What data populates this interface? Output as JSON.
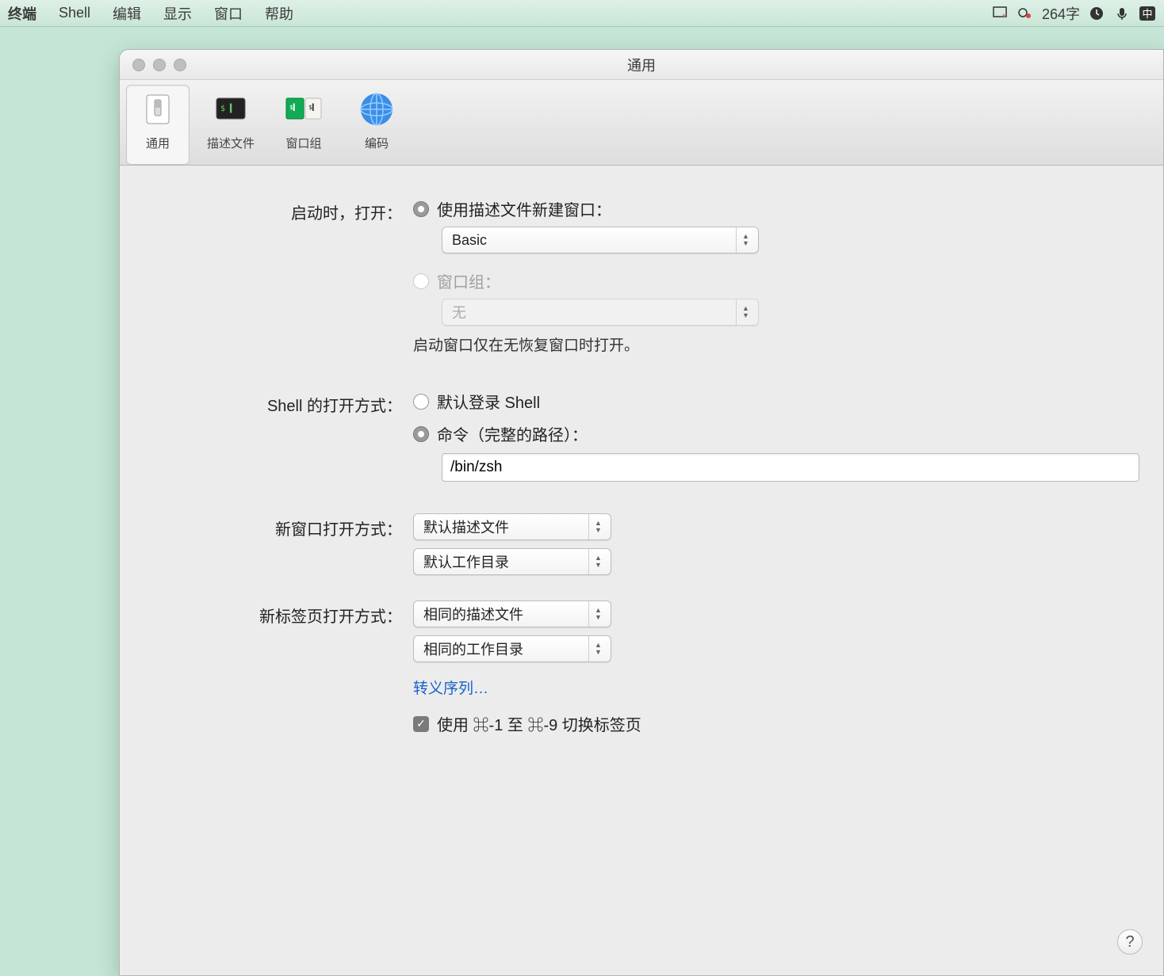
{
  "menubar": {
    "app": "终端",
    "items": [
      "Shell",
      "编辑",
      "显示",
      "窗口",
      "帮助"
    ],
    "word_count": "264字"
  },
  "window": {
    "title": "通用"
  },
  "toolbar": {
    "general": "通用",
    "profiles": "描述文件",
    "window_groups": "窗口组",
    "encodings": "编码"
  },
  "startup": {
    "label": "启动时，打开：",
    "opt_profile": "使用描述文件新建窗口：",
    "profile_value": "Basic",
    "opt_group": "窗口组：",
    "group_value": "无",
    "hint": "启动窗口仅在无恢复窗口时打开。"
  },
  "shell": {
    "label": "Shell 的打开方式：",
    "opt_default": "默认登录 Shell",
    "opt_command": "命令（完整的路径）：",
    "command_value": "/bin/zsh"
  },
  "new_window": {
    "label": "新窗口打开方式：",
    "profile": "默认描述文件",
    "dir": "默认工作目录"
  },
  "new_tab": {
    "label": "新标签页打开方式：",
    "profile": "相同的描述文件",
    "dir": "相同的工作目录"
  },
  "escape_link": "转义序列…",
  "cmd_switch": "使用 ⌘-1 至 ⌘-9 切换标签页"
}
